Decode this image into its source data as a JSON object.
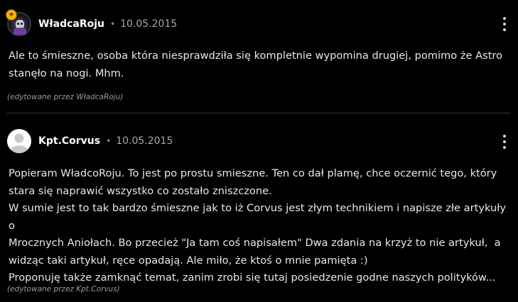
{
  "comments": [
    {
      "username": "WładcaRoju",
      "separator": "•",
      "date": "10.05.2015",
      "text": "Ale to śmieszne, osoba która niesprawdziła się kompletnie wypomina drugiej, pomimo że Astro\nstanęło na nogi. Mhm.",
      "edited": "(edytowane przez WładcaRoju)",
      "avatar_icon": "user-avatar-image",
      "badge_icon": "star-badge-icon",
      "menu_icon": "more-options-icon"
    },
    {
      "username": "Kpt.Corvus",
      "separator": "•",
      "date": "10.05.2015",
      "text": "Popieram WładcoRoju. To jest po prostu smieszne. Ten co dał plamę, chce oczernić tego, który\nstara się naprawić wszystko co zostało zniszczone.\nW sumie jest to tak bardzo śmieszne jak to iż Corvus jest złym technikiem i napisze złe artykuły o\nMrocznych Aniołach. Bo przecież \"Ja tam coś napisałem\" Dwa zdania na krzyż to nie artykuł,  a\nwidząc taki artykuł, ręce opadają. Ale miło, że ktoś o mnie pamięta :)\nProponuję także zamknąć temat, zanim zrobi się tutaj posiedzenie godne naszych polityków...",
      "edited": "(edytowane przez Kpt.Corvus)",
      "avatar_icon": "default-avatar-icon",
      "menu_icon": "more-options-icon"
    }
  ],
  "colors": {
    "background": "#000000",
    "text": "#e8e8e8",
    "username": "#ffffff",
    "meta": "#a8a8a8",
    "divider": "#3a3a3a",
    "badge": "#f2b400"
  }
}
